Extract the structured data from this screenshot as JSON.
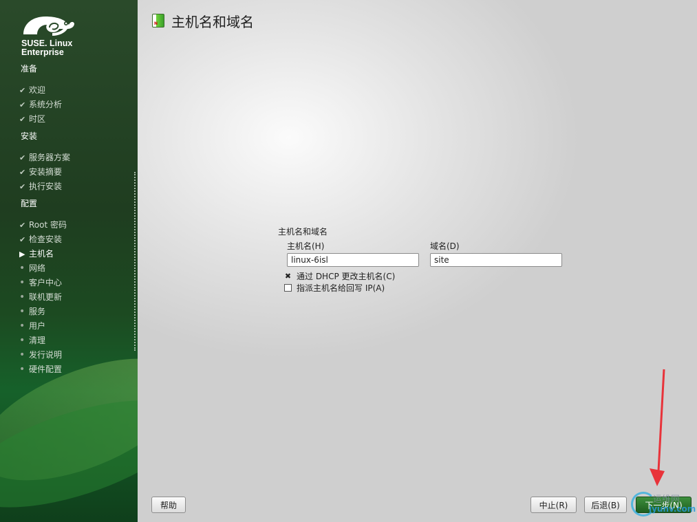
{
  "sidebar": {
    "logo_line1": "SUSE. Linux",
    "logo_line2": "Enterprise",
    "sections": [
      {
        "title": "准备",
        "steps": [
          {
            "label": "欢迎",
            "state": "done"
          },
          {
            "label": "系统分析",
            "state": "done"
          },
          {
            "label": "时区",
            "state": "done"
          }
        ]
      },
      {
        "title": "安装",
        "steps": [
          {
            "label": "服务器方案",
            "state": "done"
          },
          {
            "label": "安装摘要",
            "state": "done"
          },
          {
            "label": "执行安装",
            "state": "done"
          }
        ]
      },
      {
        "title": "配置",
        "steps": [
          {
            "label": "Root 密码",
            "state": "done"
          },
          {
            "label": "检查安装",
            "state": "done"
          },
          {
            "label": "主机名",
            "state": "current"
          },
          {
            "label": "网络",
            "state": "pending"
          },
          {
            "label": "客户中心",
            "state": "pending"
          },
          {
            "label": "联机更新",
            "state": "pending"
          },
          {
            "label": "服务",
            "state": "pending"
          },
          {
            "label": "用户",
            "state": "pending"
          },
          {
            "label": "清理",
            "state": "pending"
          },
          {
            "label": "发行说明",
            "state": "pending"
          },
          {
            "label": "硬件配置",
            "state": "pending"
          }
        ]
      }
    ],
    "markers": {
      "done": "✔",
      "current": "▶",
      "pending": "•"
    }
  },
  "main": {
    "title": "主机名和域名",
    "group_label": "主机名和域名",
    "hostname_label": "主机名(H)",
    "hostname_value": "linux-6isl",
    "domain_label": "域名(D)",
    "domain_value": "site",
    "dhcp_label": "通过 DHCP 更改主机名(C)",
    "dhcp_checked": true,
    "assign_ip_label": "指派主机名给回写 IP(A)",
    "assign_ip_checked": false
  },
  "buttons": {
    "help": "帮助",
    "abort": "中止(R)",
    "back": "后退(B)",
    "next": "下一步(N)"
  },
  "watermark": {
    "line1": "运维网",
    "line2": "iyunv.com"
  },
  "colors": {
    "sidebar_green": "#1f3d20",
    "primary_button": "#2f7a2f",
    "annotation_arrow": "#e8333a"
  }
}
